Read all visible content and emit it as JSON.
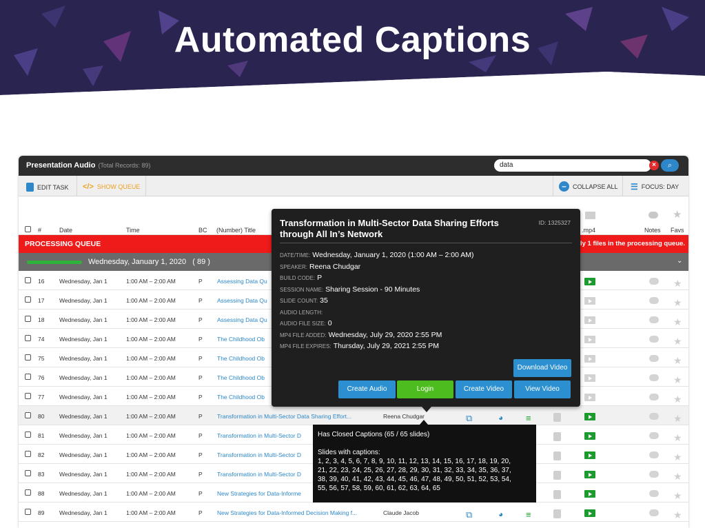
{
  "banner": {
    "title": "Automated Captions"
  },
  "app": {
    "title": "Presentation Audio",
    "total_records": "(Total Records: 89)",
    "search": {
      "value": "data"
    },
    "toolbar": {
      "edit_task": "EDIT TASK",
      "show_queue": "SHOW QUEUE",
      "collapse_all": "COLLAPSE ALL",
      "focus_day": "FOCUS: DAY"
    },
    "columns": {
      "num": "#",
      "date": "Date",
      "time": "Time",
      "bc": "BC",
      "title": "(Number) Title",
      "mp4": ".mp4",
      "notes": "Notes",
      "favs": "Favs"
    },
    "processing_queue": {
      "label": "PROCESSING QUEUE",
      "message": "ly 1 files in the processing queue."
    },
    "group": {
      "date": "Wednesday, January 1, 2020",
      "count": "( 89 )"
    },
    "rows": [
      {
        "num": "16",
        "date": "Wednesday, Jan 1",
        "time": "1:00 AM – 2:00 AM",
        "bc": "P",
        "title": "Assessing Data Qu",
        "speaker": "",
        "full": false
      },
      {
        "num": "17",
        "date": "Wednesday, Jan 1",
        "time": "1:00 AM – 2:00 AM",
        "bc": "P",
        "title": "Assessing Data Qu",
        "speaker": "",
        "full": false
      },
      {
        "num": "18",
        "date": "Wednesday, Jan 1",
        "time": "1:00 AM – 2:00 AM",
        "bc": "P",
        "title": "Assessing Data Qu",
        "speaker": "",
        "full": false
      },
      {
        "num": "74",
        "date": "Wednesday, Jan 1",
        "time": "1:00 AM – 2:00 AM",
        "bc": "P",
        "title": "The Childhood Ob",
        "speaker": "",
        "full": false
      },
      {
        "num": "75",
        "date": "Wednesday, Jan 1",
        "time": "1:00 AM – 2:00 AM",
        "bc": "P",
        "title": "The Childhood Ob",
        "speaker": "",
        "full": false
      },
      {
        "num": "76",
        "date": "Wednesday, Jan 1",
        "time": "1:00 AM – 2:00 AM",
        "bc": "P",
        "title": "The Childhood Ob",
        "speaker": "",
        "full": false
      },
      {
        "num": "77",
        "date": "Wednesday, Jan 1",
        "time": "1:00 AM – 2:00 AM",
        "bc": "P",
        "title": "The Childhood Ob",
        "speaker": "",
        "full": false
      },
      {
        "num": "80",
        "date": "Wednesday, Jan 1",
        "time": "1:00 AM – 2:00 AM",
        "bc": "P",
        "title": "Transformation in Multi-Sector Data Sharing Effort...",
        "speaker": "Reena Chudgar",
        "full": true
      },
      {
        "num": "81",
        "date": "Wednesday, Jan 1",
        "time": "1:00 AM – 2:00 AM",
        "bc": "P",
        "title": "Transformation in Multi-Sector D",
        "speaker": "",
        "full": true
      },
      {
        "num": "82",
        "date": "Wednesday, Jan 1",
        "time": "1:00 AM – 2:00 AM",
        "bc": "P",
        "title": "Transformation in Multi-Sector D",
        "speaker": "",
        "full": true
      },
      {
        "num": "83",
        "date": "Wednesday, Jan 1",
        "time": "1:00 AM – 2:00 AM",
        "bc": "P",
        "title": "Transformation in Multi-Sector D",
        "speaker": "",
        "full": true
      },
      {
        "num": "88",
        "date": "Wednesday, Jan 1",
        "time": "1:00 AM – 2:00 AM",
        "bc": "P",
        "title": "New Strategies for Data-Informe",
        "speaker": "",
        "full": true
      },
      {
        "num": "89",
        "date": "Wednesday, Jan 1",
        "time": "1:00 AM – 2:00 AM",
        "bc": "P",
        "title": "New Strategies for Data-Informed Decision Making f...",
        "speaker": "Claude Jacob",
        "full": true
      }
    ]
  },
  "popup": {
    "title": "Transformation in Multi-Sector Data Sharing Efforts through All In’s Network",
    "id": "ID: 1325327",
    "fields": [
      {
        "k": "Date/Time:",
        "v": "Wednesday, January 1, 2020 (1:00 AM – 2:00 AM)"
      },
      {
        "k": "Speaker:",
        "v": "Reena Chudgar"
      },
      {
        "k": "Build Code:",
        "v": "P"
      },
      {
        "k": "Session Name:",
        "v": "Sharing Session - 90 Minutes"
      },
      {
        "k": "Slide Count:",
        "v": "35"
      },
      {
        "k": "Audio Length:",
        "v": ""
      },
      {
        "k": "Audio File Size:",
        "v": "0"
      },
      {
        "k": "MP4 File Added:",
        "v": "Wednesday, July 29, 2020 2:55 PM"
      },
      {
        "k": "MP4 File Expires:",
        "v": "Thursday, July 29, 2021 2:55 PM"
      }
    ],
    "buttons": {
      "download_video": "Download Video",
      "create_audio": "Create Audio",
      "login": "Login",
      "create_video": "Create Video",
      "view_video": "View Video"
    }
  },
  "tooltip": {
    "heading": "Has Closed Captions (65 / 65 slides)",
    "sub": "Slides with captions:",
    "lines": [
      "1, 2, 3, 4, 5, 6, 7, 8, 9, 10, 11, 12, 13, 14, 15, 16, 17, 18, 19, 20,",
      "21, 22, 23, 24, 25, 26, 27, 28, 29, 30, 31, 32, 33, 34, 35, 36, 37,",
      "38, 39, 40, 41, 42, 43, 44, 45, 46, 47, 48, 49, 50, 51, 52, 53, 54,",
      "55, 56, 57, 58, 59, 60, 61, 62, 63, 64, 65"
    ]
  },
  "colors": {
    "accent": "#2d87c9",
    "queue": "#ef1a1a",
    "login": "#4cbc1e",
    "banner": "#2a2451"
  }
}
